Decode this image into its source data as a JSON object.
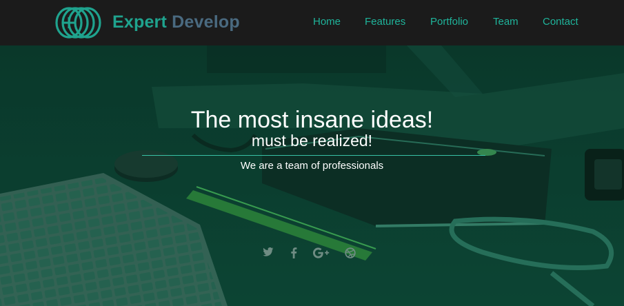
{
  "brand": {
    "name_part1": "Expert",
    "name_part2": "Develop",
    "colors": {
      "primary": "#1fa38e",
      "secondary": "#4a6a80",
      "nav_bg": "#1b1b1b"
    }
  },
  "nav": {
    "items": [
      {
        "label": "Home"
      },
      {
        "label": "Features"
      },
      {
        "label": "Portfolio"
      },
      {
        "label": "Team"
      },
      {
        "label": "Contact"
      }
    ]
  },
  "hero": {
    "title": "The most insane ideas!",
    "subtitle": "must be realized!",
    "tagline": "We are a team of professionals",
    "overlay_color": "#0f4535"
  },
  "social": {
    "icons": [
      {
        "name": "twitter-icon",
        "glyph": "🐦"
      },
      {
        "name": "facebook-icon",
        "glyph": "f"
      },
      {
        "name": "google-plus-icon",
        "glyph": "G+"
      },
      {
        "name": "dribbble-icon",
        "glyph": "◎"
      }
    ]
  }
}
